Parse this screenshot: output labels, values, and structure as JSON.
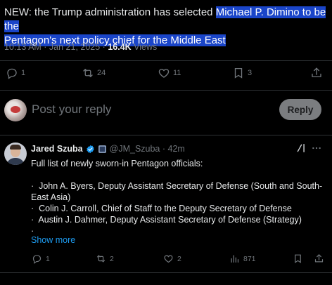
{
  "main_tweet": {
    "text_plain": "NEW: the Trump administration has selected ",
    "text_highlight_1": "Michael P. Dimino to be the",
    "text_highlight_2": "Pentagon's next policy chief for the Middle East",
    "timestamp": "10:13 AM · Jan 21, 2025 · ",
    "views_count": "16.4K",
    "views_label": " Views",
    "actions": {
      "replies": "1",
      "reposts": "24",
      "likes": "11",
      "bookmarks": "3"
    }
  },
  "composer": {
    "placeholder": "Post your reply",
    "reply_button": "Reply"
  },
  "reply_tweet": {
    "author_name": "Jared Szuba",
    "handle": "@JM_Szuba · 42m",
    "lines": [
      "Full list of newly sworn-in Pentagon officials:",
      "",
      "·  John A. Byers, Deputy Assistant Secretary of Defense (South and South-East Asia)",
      "·  Colin J. Carroll, Chief of Staff to the Deputy Secretary of Defense",
      "·  Austin J. Dahmer, Deputy Assistant Secretary of Defense (Strategy)",
      "·"
    ],
    "show_more": "Show more",
    "actions": {
      "replies": "1",
      "reposts": "2",
      "likes": "2",
      "views": "871"
    }
  },
  "colors": {
    "background": "#000000",
    "text": "#e7e9ea",
    "muted": "#71767b",
    "accent": "#1d9bf0",
    "highlight": "#1a45c9"
  }
}
